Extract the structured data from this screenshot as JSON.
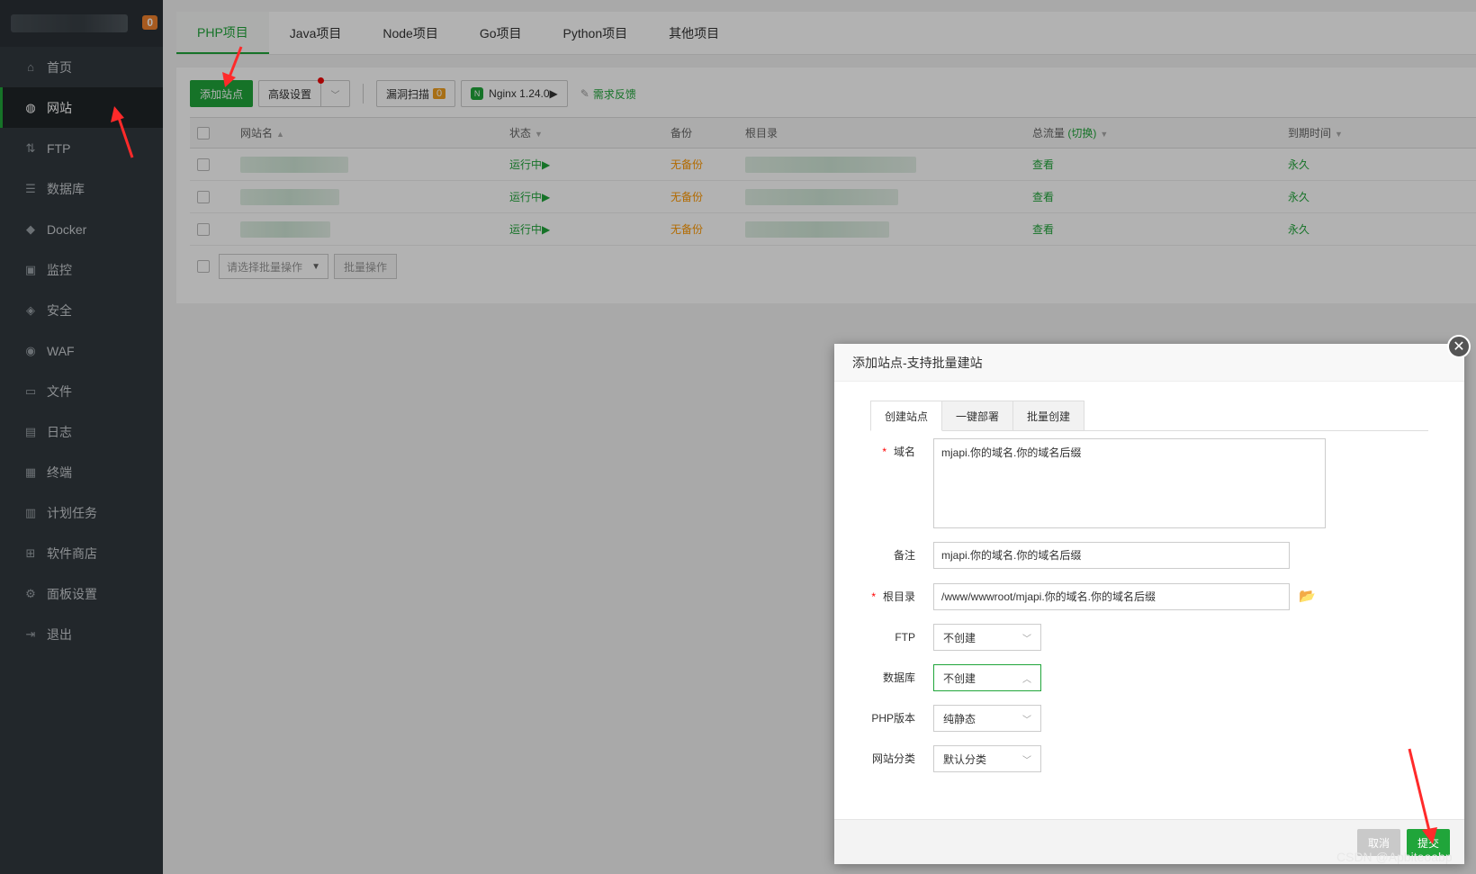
{
  "sidebar": {
    "badge": "0",
    "items": [
      {
        "label": "首页",
        "icon": "home-icon",
        "glyph": "⌂"
      },
      {
        "label": "网站",
        "icon": "globe-icon",
        "glyph": "◍"
      },
      {
        "label": "FTP",
        "icon": "ftp-icon",
        "glyph": "⇅"
      },
      {
        "label": "数据库",
        "icon": "database-icon",
        "glyph": "☰"
      },
      {
        "label": "Docker",
        "icon": "docker-icon",
        "glyph": "◆"
      },
      {
        "label": "监控",
        "icon": "monitor-icon",
        "glyph": "▣"
      },
      {
        "label": "安全",
        "icon": "shield-icon",
        "glyph": "◈"
      },
      {
        "label": "WAF",
        "icon": "waf-icon",
        "glyph": "◉"
      },
      {
        "label": "文件",
        "icon": "folder-icon",
        "glyph": "▭"
      },
      {
        "label": "日志",
        "icon": "log-icon",
        "glyph": "▤"
      },
      {
        "label": "终端",
        "icon": "terminal-icon",
        "glyph": "▦"
      },
      {
        "label": "计划任务",
        "icon": "calendar-icon",
        "glyph": "▥"
      },
      {
        "label": "软件商店",
        "icon": "store-icon",
        "glyph": "⊞"
      },
      {
        "label": "面板设置",
        "icon": "gear-icon",
        "glyph": "⚙"
      },
      {
        "label": "退出",
        "icon": "logout-icon",
        "glyph": "⇥"
      }
    ]
  },
  "project_tabs": [
    "PHP项目",
    "Java项目",
    "Node项目",
    "Go项目",
    "Python项目",
    "其他项目"
  ],
  "toolbar": {
    "add_site": "添加站点",
    "advanced": "高级设置",
    "vuln_scan": "漏洞扫描",
    "vuln_count": "0",
    "nginx": "Nginx 1.24.0▶",
    "feedback": "需求反馈"
  },
  "table": {
    "headers": {
      "name": "网站名",
      "status": "状态",
      "backup": "备份",
      "root": "根目录",
      "traffic": "总流量",
      "traffic_switch": "(切换)",
      "expire": "到期时间"
    },
    "rows": [
      {
        "status": "运行中▶",
        "backup": "无备份",
        "traffic": "查看",
        "expire": "永久"
      },
      {
        "status": "运行中▶",
        "backup": "无备份",
        "traffic": "查看",
        "expire": "永久"
      },
      {
        "status": "运行中▶",
        "backup": "无备份",
        "traffic": "查看",
        "expire": "永久"
      }
    ],
    "bulk_placeholder": "请选择批量操作",
    "bulk_button": "批量操作"
  },
  "modal": {
    "title": "添加站点-支持批量建站",
    "tabs": [
      "创建站点",
      "一键部署",
      "批量创建"
    ],
    "fields": {
      "domain_label": "域名",
      "domain_value": "mjapi.你的域名.你的域名后缀",
      "remark_label": "备注",
      "remark_value": "mjapi.你的域名.你的域名后缀",
      "root_label": "根目录",
      "root_value": "/www/wwwroot/mjapi.你的域名.你的域名后缀",
      "ftp_label": "FTP",
      "ftp_value": "不创建",
      "db_label": "数据库",
      "db_value": "不创建",
      "php_label": "PHP版本",
      "php_value": "纯静态",
      "category_label": "网站分类",
      "category_value": "默认分类"
    },
    "cancel": "取消",
    "submit": "提交"
  },
  "watermark": "CSDN @Apbiteoabp",
  "colors": {
    "accent": "#20a53a",
    "sidebar": "#31383e",
    "warning": "#ff9900"
  }
}
